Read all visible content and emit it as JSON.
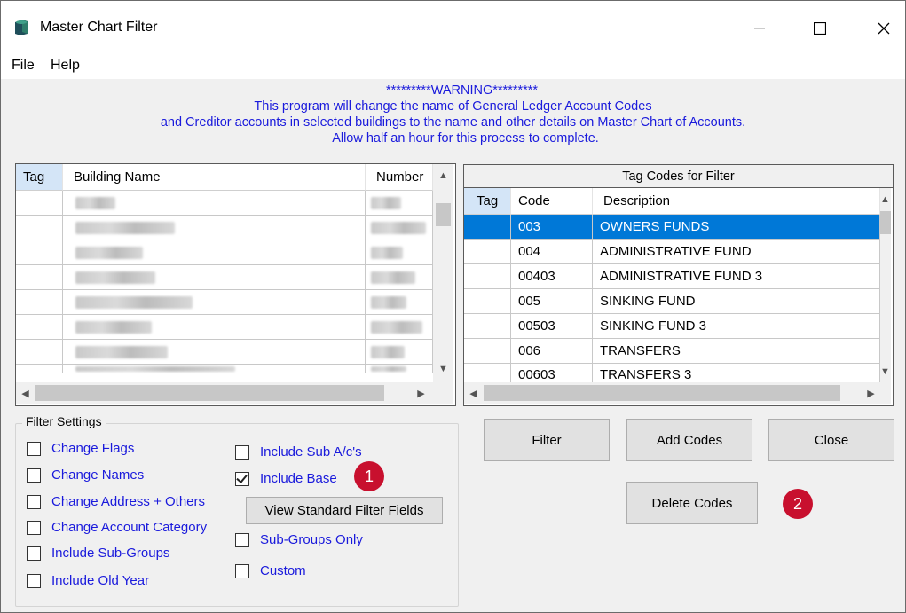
{
  "window": {
    "title": "Master Chart Filter"
  },
  "menu": {
    "file": "File",
    "help": "Help"
  },
  "warning": {
    "line1": "*********WARNING*********",
    "line2": "This program will change the name of General Ledger Account Codes",
    "line3": "and Creditor accounts in  selected buildings to the name and other details on Master Chart of Accounts.",
    "line4": "Allow half an hour for this process to complete."
  },
  "buildings": {
    "headers": {
      "tag": "Tag",
      "name": "Building Name",
      "number": "Number"
    }
  },
  "tag_codes": {
    "title": "Tag Codes for Filter",
    "headers": {
      "tag": "Tag",
      "code": "Code",
      "description": "Description"
    },
    "rows": [
      {
        "code": "003",
        "description": "OWNERS FUNDS"
      },
      {
        "code": "004",
        "description": "ADMINISTRATIVE FUND"
      },
      {
        "code": "00403",
        "description": "ADMINISTRATIVE FUND 3"
      },
      {
        "code": "005",
        "description": "SINKING FUND"
      },
      {
        "code": "00503",
        "description": "SINKING FUND 3"
      },
      {
        "code": "006",
        "description": "TRANSFERS"
      },
      {
        "code": "00603",
        "description": "TRANSFERS 3"
      }
    ]
  },
  "filter_settings": {
    "title": "Filter Settings",
    "change_flags": "Change Flags",
    "change_names": "Change Names",
    "change_address": "Change Address + Others",
    "change_category": "Change Account Category",
    "include_subgroups": "Include Sub-Groups",
    "include_old_year": "Include Old Year",
    "include_sub_ac": "Include Sub A/c's",
    "include_base": "Include Base",
    "view_standard": "View Standard Filter Fields",
    "subgroups_only": "Sub-Groups Only",
    "custom": "Custom"
  },
  "buttons": {
    "filter": "Filter",
    "add_codes": "Add Codes",
    "close": "Close",
    "delete_codes": "Delete Codes"
  },
  "badges": {
    "one": "1",
    "two": "2"
  },
  "colors": {
    "label_blue": "#1a1adc",
    "selection": "#0078d7",
    "badge_red": "#c8102e"
  }
}
